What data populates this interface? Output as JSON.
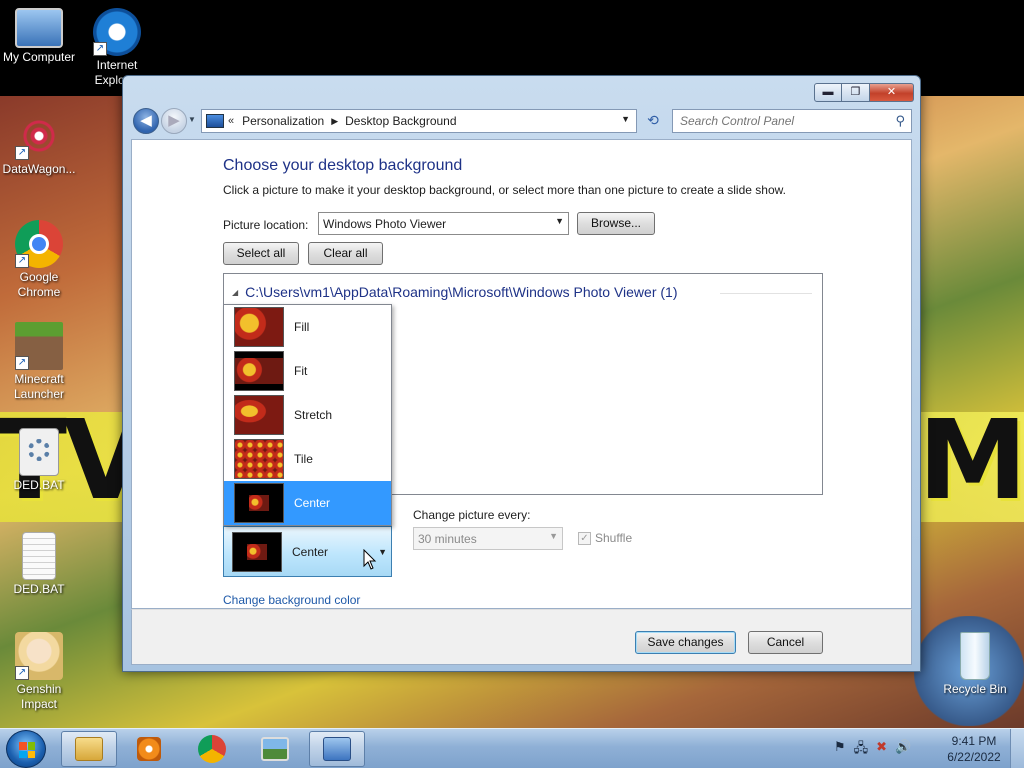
{
  "desktop": {
    "icons": [
      {
        "label": "My Computer"
      },
      {
        "label": "Internet Explorer"
      },
      {
        "label": "DataWagon..."
      },
      {
        "label": "Google Chrome"
      },
      {
        "label": "Minecraft Launcher"
      },
      {
        "label": "DED.BAT"
      },
      {
        "label": "DED.BAT"
      },
      {
        "label": "Genshin Impact"
      },
      {
        "label": "Recycle Bin"
      }
    ]
  },
  "window": {
    "controls": {
      "minimize": "▬",
      "maximize": "❐",
      "close": "✕"
    },
    "nav": {
      "back_glyph": "◀",
      "forward_glyph": "▶"
    },
    "address": {
      "chevron": "«",
      "crumbs": [
        "Personalization",
        "Desktop Background"
      ],
      "separator": "▶"
    },
    "search": {
      "placeholder": "Search Control Panel"
    },
    "title": "Choose your desktop background",
    "description": "Click a picture to make it your desktop background, or select more than one picture to create a slide show.",
    "picture_location_label": "Picture location:",
    "picture_location_value": "Windows Photo Viewer",
    "browse_label": "Browse...",
    "select_all_label": "Select all",
    "clear_all_label": "Clear all",
    "folder_group": "C:\\Users\\vm1\\AppData\\Roaming\\Microsoft\\Windows Photo Viewer (1)",
    "picture_position": {
      "options": [
        "Fill",
        "Fit",
        "Stretch",
        "Tile",
        "Center"
      ],
      "selected": "Center"
    },
    "change_picture_label": "Change picture every:",
    "interval_value": "30 minutes",
    "shuffle_label": "Shuffle",
    "shuffle_checked": true,
    "bg_color_link": "Change background color",
    "save_label": "Save changes",
    "cancel_label": "Cancel"
  },
  "taskbar": {
    "time": "9:41 PM",
    "date": "6/22/2022"
  },
  "colors": {
    "accent": "#3399ff",
    "title_text": "#1e3287",
    "link": "#1e59a8"
  }
}
